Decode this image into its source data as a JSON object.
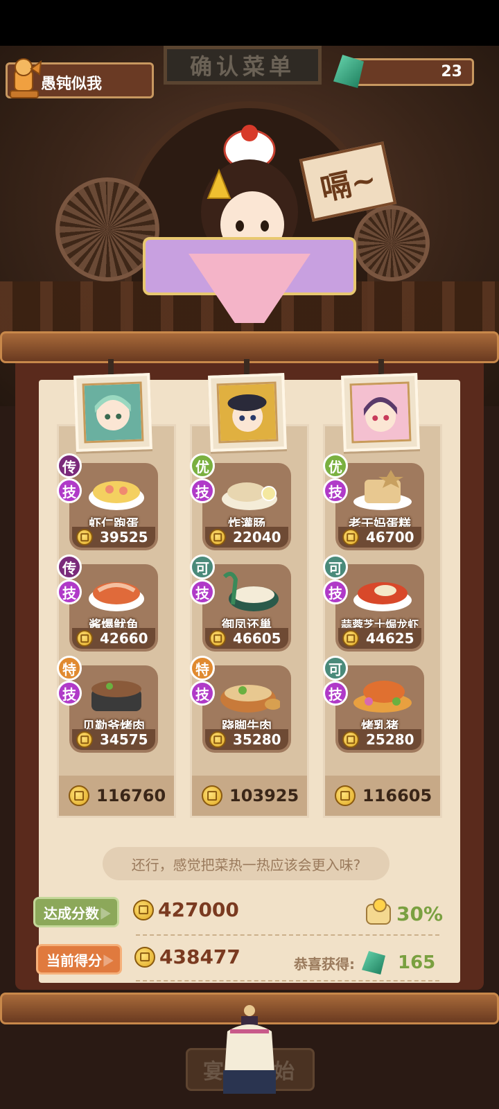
{
  "status_bar": {},
  "header": {
    "player_name": "愚钝似我",
    "title_sign": "确认菜单",
    "gem_count": "23"
  },
  "character_speech": "嗝~",
  "columns": [
    {
      "chef": "chef-1",
      "total": "116760",
      "dishes": [
        {
          "grade": "传",
          "skill": "技",
          "name": "虾仁跑蛋",
          "price": "39525"
        },
        {
          "grade": "传",
          "skill": "技",
          "name": "酱爆鱿鱼",
          "price": "42660"
        },
        {
          "grade": "特",
          "skill": "技",
          "name": "贝勒爷烤肉",
          "price": "34575"
        }
      ]
    },
    {
      "chef": "chef-2",
      "total": "103925",
      "dishes": [
        {
          "grade": "优",
          "skill": "技",
          "name": "炸灌肠",
          "price": "22040"
        },
        {
          "grade": "可",
          "skill": "技",
          "name": "御凤还巢",
          "price": "46605"
        },
        {
          "grade": "特",
          "skill": "技",
          "name": "跷脚牛肉",
          "price": "35280"
        }
      ]
    },
    {
      "chef": "chef-3",
      "total": "116605",
      "dishes": [
        {
          "grade": "优",
          "skill": "技",
          "name": "老干妈蛋糕",
          "price": "46700"
        },
        {
          "grade": "可",
          "skill": "技",
          "name": "蒜蓉芝士焗龙虾",
          "price": "44625"
        },
        {
          "grade": "可",
          "skill": "技",
          "name": "烤乳猪",
          "price": "25280"
        }
      ]
    }
  ],
  "grade_colors": {
    "传": "#7a2a7a",
    "特": "#e08a30",
    "优": "#7ab040",
    "可": "#4a8a7a"
  },
  "comment": "还行，感觉把菜热一热应该会更入味?",
  "target": {
    "label": "达成分数",
    "score": "427000",
    "bonus_percent": "30%"
  },
  "current": {
    "label": "当前得分",
    "score": "438477",
    "reward_label": "恭喜获得:",
    "reward_value": "165"
  },
  "start_button": "宴会开始"
}
